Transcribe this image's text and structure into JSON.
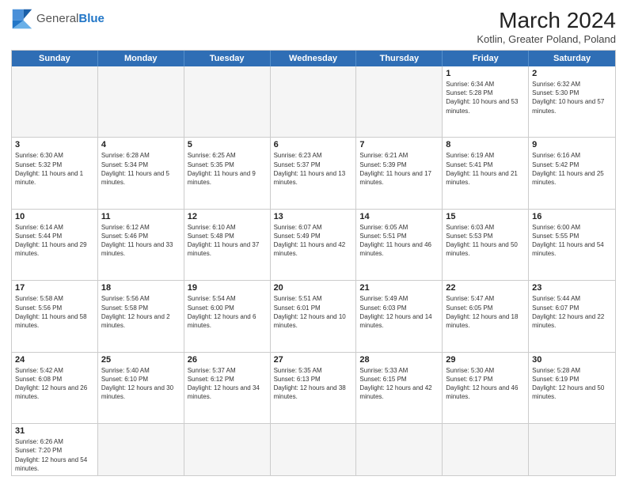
{
  "header": {
    "logo_general": "General",
    "logo_blue": "Blue",
    "month_year": "March 2024",
    "location": "Kotlin, Greater Poland, Poland"
  },
  "days_of_week": [
    "Sunday",
    "Monday",
    "Tuesday",
    "Wednesday",
    "Thursday",
    "Friday",
    "Saturday"
  ],
  "weeks": [
    [
      {
        "day": "",
        "info": ""
      },
      {
        "day": "",
        "info": ""
      },
      {
        "day": "",
        "info": ""
      },
      {
        "day": "",
        "info": ""
      },
      {
        "day": "",
        "info": ""
      },
      {
        "day": "1",
        "info": "Sunrise: 6:34 AM\nSunset: 5:28 PM\nDaylight: 10 hours and 53 minutes."
      },
      {
        "day": "2",
        "info": "Sunrise: 6:32 AM\nSunset: 5:30 PM\nDaylight: 10 hours and 57 minutes."
      }
    ],
    [
      {
        "day": "3",
        "info": "Sunrise: 6:30 AM\nSunset: 5:32 PM\nDaylight: 11 hours and 1 minute."
      },
      {
        "day": "4",
        "info": "Sunrise: 6:28 AM\nSunset: 5:34 PM\nDaylight: 11 hours and 5 minutes."
      },
      {
        "day": "5",
        "info": "Sunrise: 6:25 AM\nSunset: 5:35 PM\nDaylight: 11 hours and 9 minutes."
      },
      {
        "day": "6",
        "info": "Sunrise: 6:23 AM\nSunset: 5:37 PM\nDaylight: 11 hours and 13 minutes."
      },
      {
        "day": "7",
        "info": "Sunrise: 6:21 AM\nSunset: 5:39 PM\nDaylight: 11 hours and 17 minutes."
      },
      {
        "day": "8",
        "info": "Sunrise: 6:19 AM\nSunset: 5:41 PM\nDaylight: 11 hours and 21 minutes."
      },
      {
        "day": "9",
        "info": "Sunrise: 6:16 AM\nSunset: 5:42 PM\nDaylight: 11 hours and 25 minutes."
      }
    ],
    [
      {
        "day": "10",
        "info": "Sunrise: 6:14 AM\nSunset: 5:44 PM\nDaylight: 11 hours and 29 minutes."
      },
      {
        "day": "11",
        "info": "Sunrise: 6:12 AM\nSunset: 5:46 PM\nDaylight: 11 hours and 33 minutes."
      },
      {
        "day": "12",
        "info": "Sunrise: 6:10 AM\nSunset: 5:48 PM\nDaylight: 11 hours and 37 minutes."
      },
      {
        "day": "13",
        "info": "Sunrise: 6:07 AM\nSunset: 5:49 PM\nDaylight: 11 hours and 42 minutes."
      },
      {
        "day": "14",
        "info": "Sunrise: 6:05 AM\nSunset: 5:51 PM\nDaylight: 11 hours and 46 minutes."
      },
      {
        "day": "15",
        "info": "Sunrise: 6:03 AM\nSunset: 5:53 PM\nDaylight: 11 hours and 50 minutes."
      },
      {
        "day": "16",
        "info": "Sunrise: 6:00 AM\nSunset: 5:55 PM\nDaylight: 11 hours and 54 minutes."
      }
    ],
    [
      {
        "day": "17",
        "info": "Sunrise: 5:58 AM\nSunset: 5:56 PM\nDaylight: 11 hours and 58 minutes."
      },
      {
        "day": "18",
        "info": "Sunrise: 5:56 AM\nSunset: 5:58 PM\nDaylight: 12 hours and 2 minutes."
      },
      {
        "day": "19",
        "info": "Sunrise: 5:54 AM\nSunset: 6:00 PM\nDaylight: 12 hours and 6 minutes."
      },
      {
        "day": "20",
        "info": "Sunrise: 5:51 AM\nSunset: 6:01 PM\nDaylight: 12 hours and 10 minutes."
      },
      {
        "day": "21",
        "info": "Sunrise: 5:49 AM\nSunset: 6:03 PM\nDaylight: 12 hours and 14 minutes."
      },
      {
        "day": "22",
        "info": "Sunrise: 5:47 AM\nSunset: 6:05 PM\nDaylight: 12 hours and 18 minutes."
      },
      {
        "day": "23",
        "info": "Sunrise: 5:44 AM\nSunset: 6:07 PM\nDaylight: 12 hours and 22 minutes."
      }
    ],
    [
      {
        "day": "24",
        "info": "Sunrise: 5:42 AM\nSunset: 6:08 PM\nDaylight: 12 hours and 26 minutes."
      },
      {
        "day": "25",
        "info": "Sunrise: 5:40 AM\nSunset: 6:10 PM\nDaylight: 12 hours and 30 minutes."
      },
      {
        "day": "26",
        "info": "Sunrise: 5:37 AM\nSunset: 6:12 PM\nDaylight: 12 hours and 34 minutes."
      },
      {
        "day": "27",
        "info": "Sunrise: 5:35 AM\nSunset: 6:13 PM\nDaylight: 12 hours and 38 minutes."
      },
      {
        "day": "28",
        "info": "Sunrise: 5:33 AM\nSunset: 6:15 PM\nDaylight: 12 hours and 42 minutes."
      },
      {
        "day": "29",
        "info": "Sunrise: 5:30 AM\nSunset: 6:17 PM\nDaylight: 12 hours and 46 minutes."
      },
      {
        "day": "30",
        "info": "Sunrise: 5:28 AM\nSunset: 6:19 PM\nDaylight: 12 hours and 50 minutes."
      }
    ],
    [
      {
        "day": "31",
        "info": "Sunrise: 6:26 AM\nSunset: 7:20 PM\nDaylight: 12 hours and 54 minutes."
      },
      {
        "day": "",
        "info": ""
      },
      {
        "day": "",
        "info": ""
      },
      {
        "day": "",
        "info": ""
      },
      {
        "day": "",
        "info": ""
      },
      {
        "day": "",
        "info": ""
      },
      {
        "day": "",
        "info": ""
      }
    ]
  ]
}
